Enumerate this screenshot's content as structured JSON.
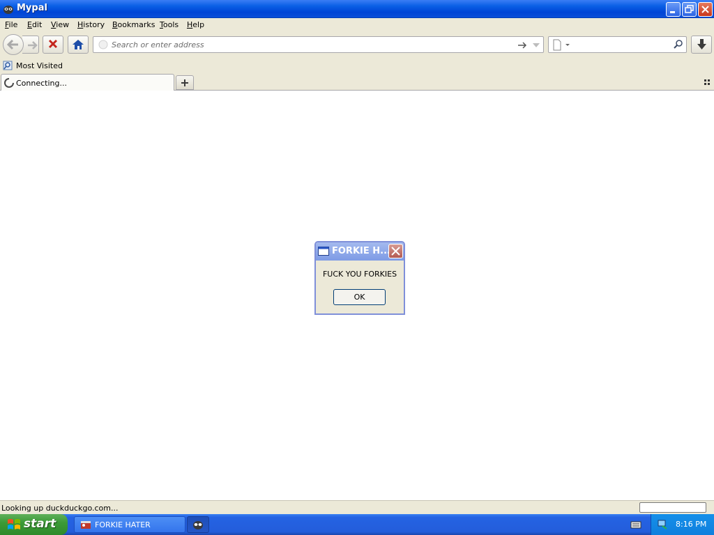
{
  "window": {
    "title": "Mypal"
  },
  "menu": {
    "items": [
      {
        "first": "F",
        "rest": "ile"
      },
      {
        "first": "E",
        "rest": "dit"
      },
      {
        "first": "V",
        "rest": "iew"
      },
      {
        "first": "",
        "u": "H",
        "pre": "",
        "rest": "istory"
      },
      {
        "first": "B",
        "rest": "ookmarks"
      },
      {
        "first": "T",
        "rest": "ools"
      },
      {
        "first": "H",
        "rest": "elp"
      }
    ]
  },
  "urlbar": {
    "placeholder": "Search or enter address"
  },
  "bookmarks": {
    "most_visited": "Most Visited"
  },
  "tab": {
    "label": "Connecting..."
  },
  "dialog": {
    "title": "FORKIE H...",
    "message": "FUCK YOU FORKIES",
    "ok_label": "OK"
  },
  "status": {
    "text": "Looking up duckduckgo.com..."
  },
  "taskbar": {
    "start_label": "start",
    "task_label": "FORKIE HATER",
    "clock": "8:16 PM"
  },
  "colors": {
    "titlebar": "#0a5fe5",
    "chrome": "#ece9d8",
    "taskbar": "#235ddb",
    "start": "#3c9a36"
  }
}
